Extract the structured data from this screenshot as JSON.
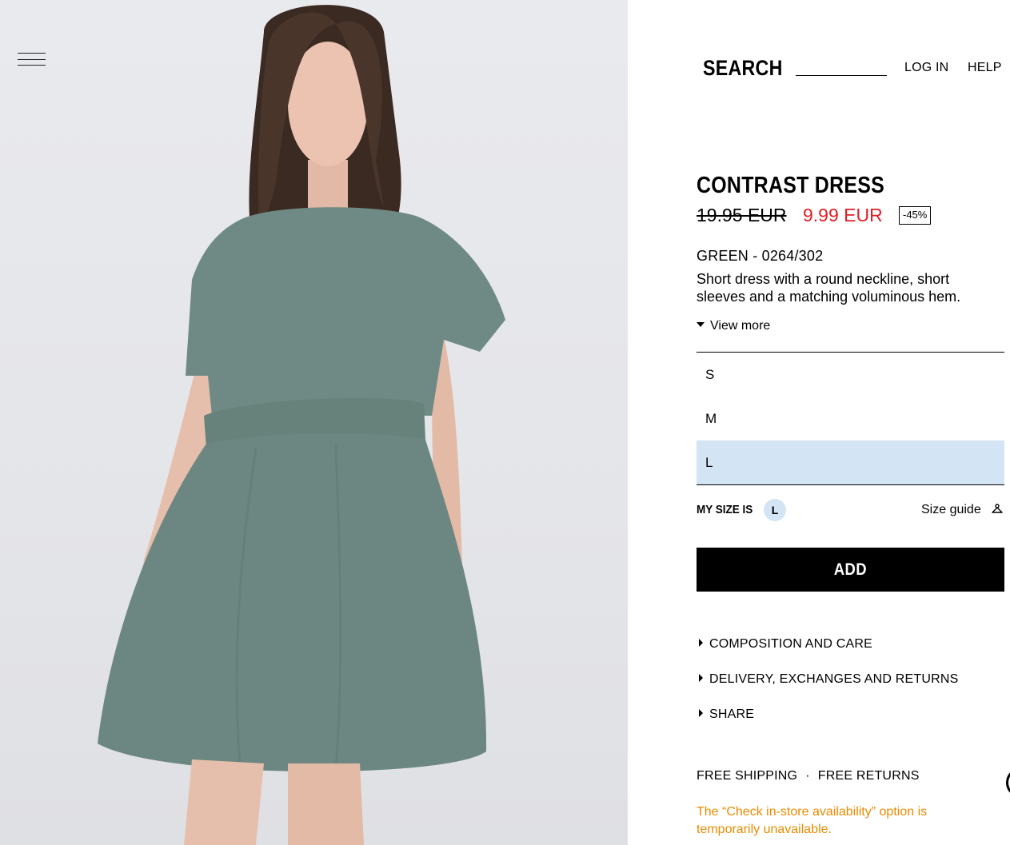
{
  "header": {
    "search_label": "SEARCH",
    "search_placeholder": "",
    "login_label": "LOG IN",
    "help_label": "HELP"
  },
  "product": {
    "name": "CONTRAST DRESS",
    "price_old": "19.95 EUR",
    "price_new": "9.99 EUR",
    "discount": "-45%",
    "color_ref": "GREEN - 0264/302",
    "description": "Short dress with a round neckline, short sleeves and a matching voluminous hem.",
    "view_more_label": "View more"
  },
  "sizes": {
    "options": [
      "S",
      "M",
      "L"
    ],
    "selected": "L"
  },
  "my_size": {
    "label": "MY SIZE IS",
    "value": "L",
    "size_guide_label": "Size guide"
  },
  "add_button_label": "ADD",
  "accordion": [
    "COMPOSITION AND CARE",
    "DELIVERY, EXCHANGES AND RETURNS",
    "SHARE"
  ],
  "shipping": {
    "free_shipping": "FREE SHIPPING",
    "separator": "·",
    "free_returns": "FREE RETURNS"
  },
  "notice": "The “Check in-store availability” option is temporarily unavailable.",
  "colors": {
    "price_sale": "#e01f26",
    "size_selected_bg": "#d3e4f5",
    "notice": "#e98b00",
    "dress": "#6f8a84"
  },
  "icons": {
    "menu": "hamburger-menu-icon",
    "size_guide": "hanger-icon"
  }
}
